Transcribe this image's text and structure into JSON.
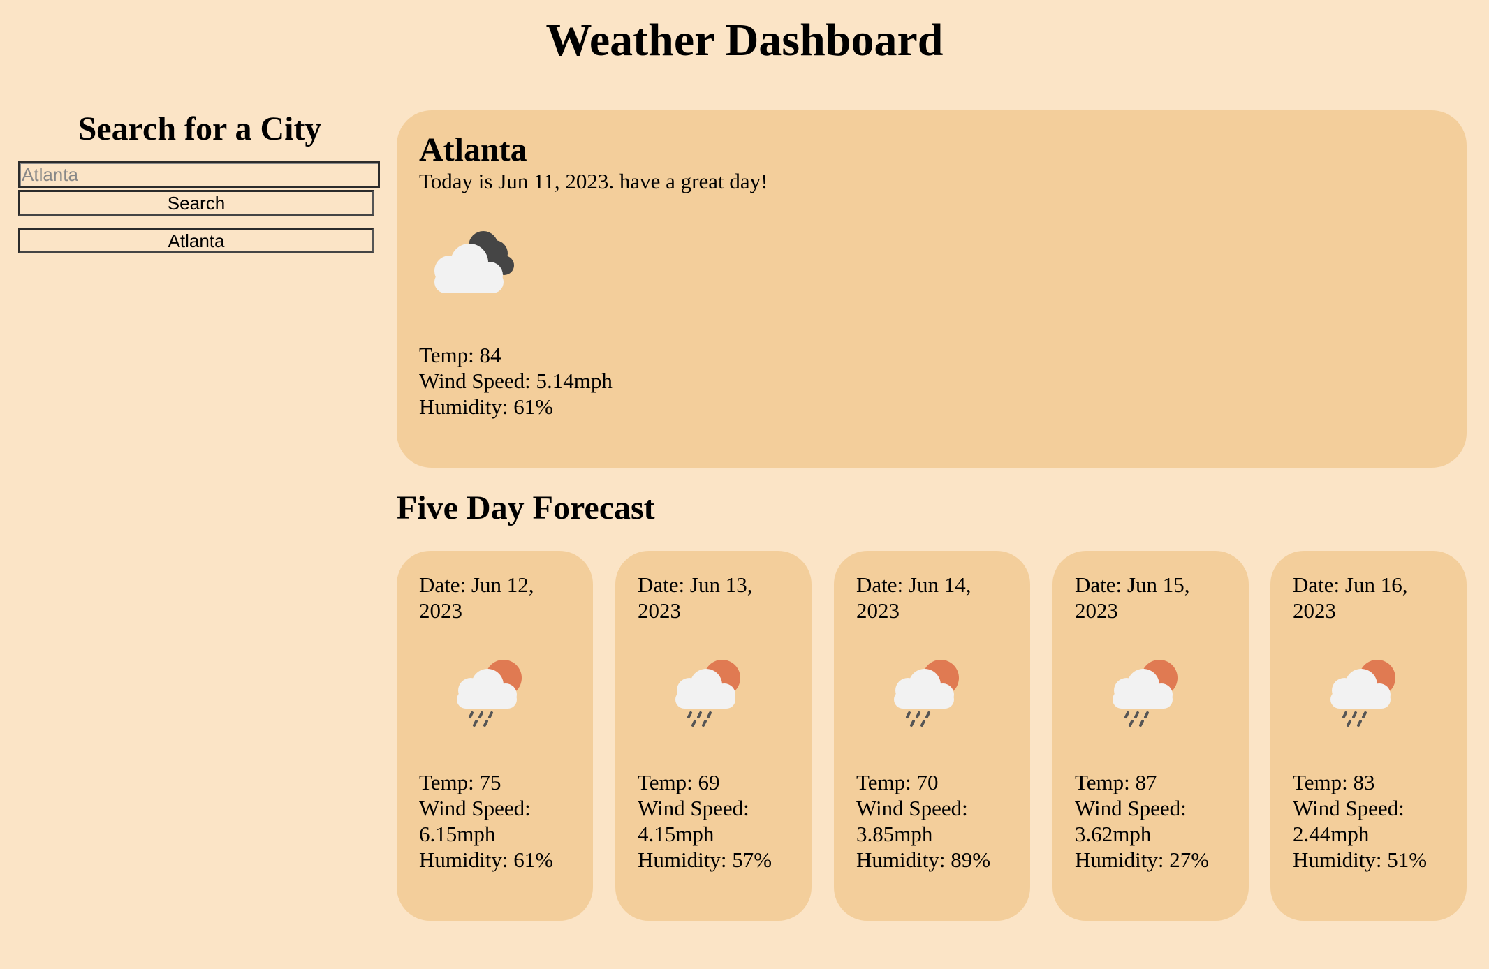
{
  "page": {
    "title": "Weather Dashboard"
  },
  "sidebar": {
    "heading": "Search for a City",
    "search_placeholder": "Atlanta",
    "search_button": "Search",
    "history": [
      "Atlanta"
    ]
  },
  "current": {
    "city": "Atlanta",
    "today": "Today is Jun 11, 2023. have a great day!",
    "icon": "cloudy-night-icon",
    "temp": "Temp: 84",
    "wind": "Wind Speed: 5.14mph",
    "humidity": "Humidity: 61%"
  },
  "forecast": {
    "heading": "Five Day Forecast",
    "days": [
      {
        "date": "Date: Jun 12, 2023",
        "icon": "rain-sun-icon",
        "temp": "Temp: 75",
        "wind": "Wind Speed: 6.15mph",
        "humidity": "Humidity: 61%"
      },
      {
        "date": "Date: Jun 13, 2023",
        "icon": "rain-sun-icon",
        "temp": "Temp: 69",
        "wind": "Wind Speed: 4.15mph",
        "humidity": "Humidity: 57%"
      },
      {
        "date": "Date: Jun 14, 2023",
        "icon": "rain-sun-icon",
        "temp": "Temp: 70",
        "wind": "Wind Speed: 3.85mph",
        "humidity": "Humidity: 89%"
      },
      {
        "date": "Date: Jun 15, 2023",
        "icon": "rain-sun-icon",
        "temp": "Temp: 87",
        "wind": "Wind Speed: 3.62mph",
        "humidity": "Humidity: 27%"
      },
      {
        "date": "Date: Jun 16, 2023",
        "icon": "rain-sun-icon",
        "temp": "Temp: 83",
        "wind": "Wind Speed: 2.44mph",
        "humidity": "Humidity: 51%"
      }
    ]
  },
  "colors": {
    "background": "#fbe4c6",
    "card": "#f3ce9b",
    "sun": "#e07a52",
    "dark_cloud": "#454545",
    "light_cloud": "#f2f2f2"
  }
}
